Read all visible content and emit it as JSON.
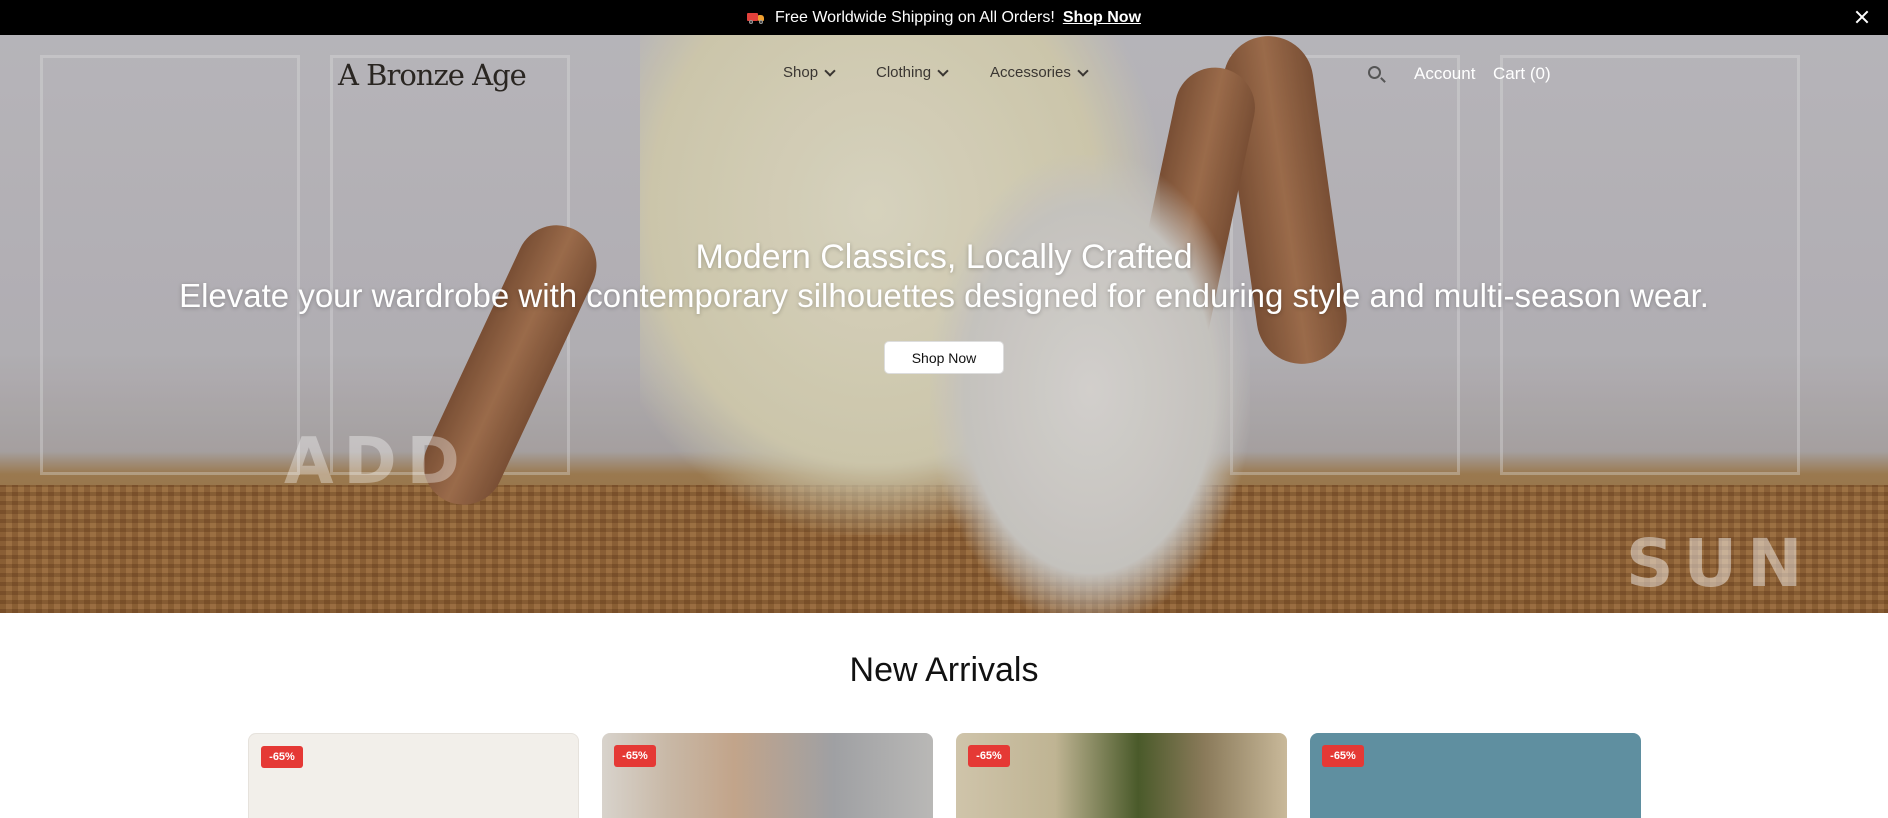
{
  "announcement": {
    "text": "Free Worldwide Shipping on All Orders!",
    "link": "Shop Now",
    "icon": "truck-icon"
  },
  "header": {
    "logo": "A Bronze Age",
    "nav": [
      {
        "label": "Shop"
      },
      {
        "label": "Clothing"
      },
      {
        "label": "Accessories"
      }
    ],
    "account": "Account",
    "cart": "Cart (0)"
  },
  "hero": {
    "title": "Modern Classics, Locally Crafted",
    "subtitle": "Elevate your wardrobe with contemporary silhouettes designed for enduring style and multi-season wear.",
    "button": "Shop Now",
    "bg_words": [
      "ADD",
      "SUN"
    ]
  },
  "new_arrivals": {
    "title": "New Arrivals",
    "products": [
      {
        "badge": "-65%"
      },
      {
        "badge": "-65%"
      },
      {
        "badge": "-65%"
      },
      {
        "badge": "-65%"
      }
    ]
  },
  "colors": {
    "announcement_bg": "#000000",
    "badge": "#e53935",
    "button_bg": "#ffffff"
  }
}
